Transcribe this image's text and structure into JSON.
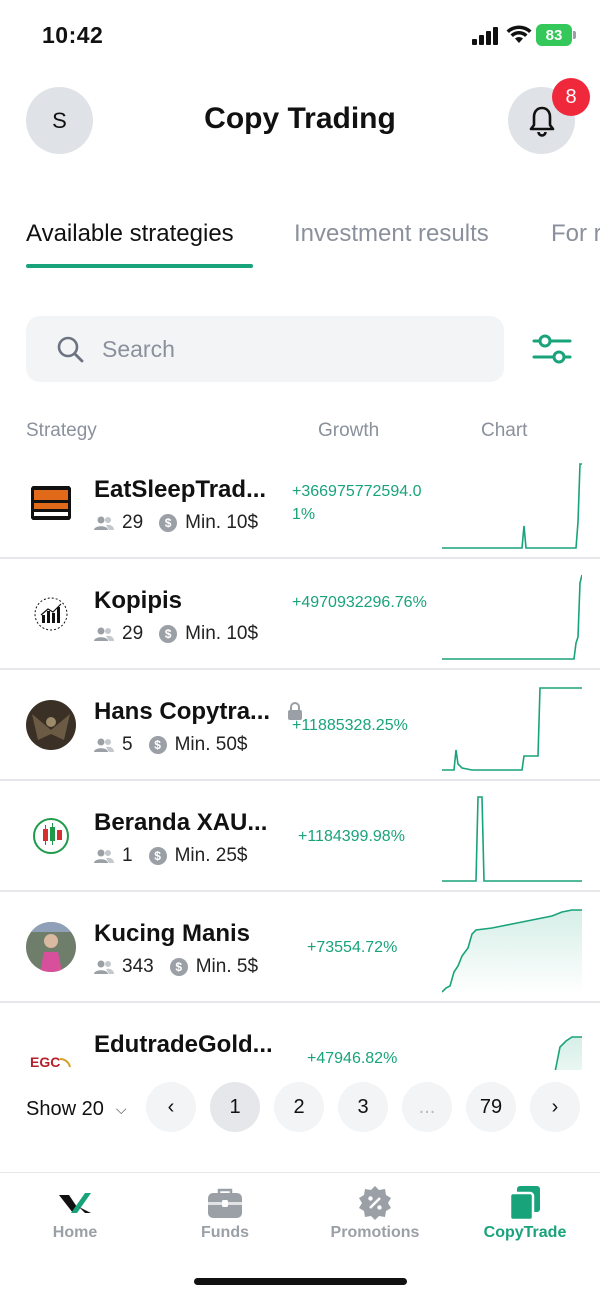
{
  "status_bar": {
    "time": "10:42",
    "battery": "83"
  },
  "header": {
    "avatar_initial": "S",
    "title": "Copy Trading",
    "notification_count": "8"
  },
  "tabs": [
    {
      "label": "Available strategies",
      "active": true
    },
    {
      "label": "Investment results",
      "active": false
    },
    {
      "label": "For r",
      "active": false
    }
  ],
  "search": {
    "placeholder": "Search",
    "value": ""
  },
  "table_header": {
    "strategy": "Strategy",
    "growth": "Growth",
    "chart": "Chart"
  },
  "strategies": [
    {
      "name": "EatSleepTrad...",
      "followers": "29",
      "min": "Min. 10$",
      "growth": "+366975772594.01%",
      "locked": false,
      "logo_text": "EAT SLEEP TRADE REPEAT"
    },
    {
      "name": "Kopipis",
      "followers": "29",
      "min": "Min. 10$",
      "growth": "+4970932296.76%",
      "locked": false,
      "logo_text": ""
    },
    {
      "name": "Hans Copytra...",
      "followers": "5",
      "min": "Min. 50$",
      "growth": "+11885328.25%",
      "locked": true,
      "logo_text": ""
    },
    {
      "name": "Beranda XAU...",
      "followers": "1",
      "min": "Min. 25$",
      "growth": "+1184399.98%",
      "locked": false,
      "logo_text": ""
    },
    {
      "name": "Kucing Manis",
      "followers": "343",
      "min": "Min. 5$",
      "growth": "+73554.72%",
      "locked": false,
      "logo_text": ""
    },
    {
      "name": "EdutradeGold...",
      "followers": "",
      "min": "",
      "growth": "+47946.82%",
      "locked": false,
      "logo_text": "EGC"
    }
  ],
  "pagination": {
    "show_label": "Show 20",
    "pages": [
      "1",
      "2",
      "3",
      "...",
      "79"
    ],
    "current": "1",
    "prev": "‹",
    "next": "›"
  },
  "bottom_nav": [
    {
      "label": "Home",
      "icon": "home-logo-icon",
      "active": false
    },
    {
      "label": "Funds",
      "icon": "briefcase-icon",
      "active": false
    },
    {
      "label": "Promotions",
      "icon": "percent-badge-icon",
      "active": false
    },
    {
      "label": "CopyTrade",
      "icon": "copy-icon",
      "active": true
    }
  ],
  "colors": {
    "accent": "#19a37a",
    "badge": "#f0283c",
    "muted": "#8a919c",
    "battery": "#34c759"
  }
}
